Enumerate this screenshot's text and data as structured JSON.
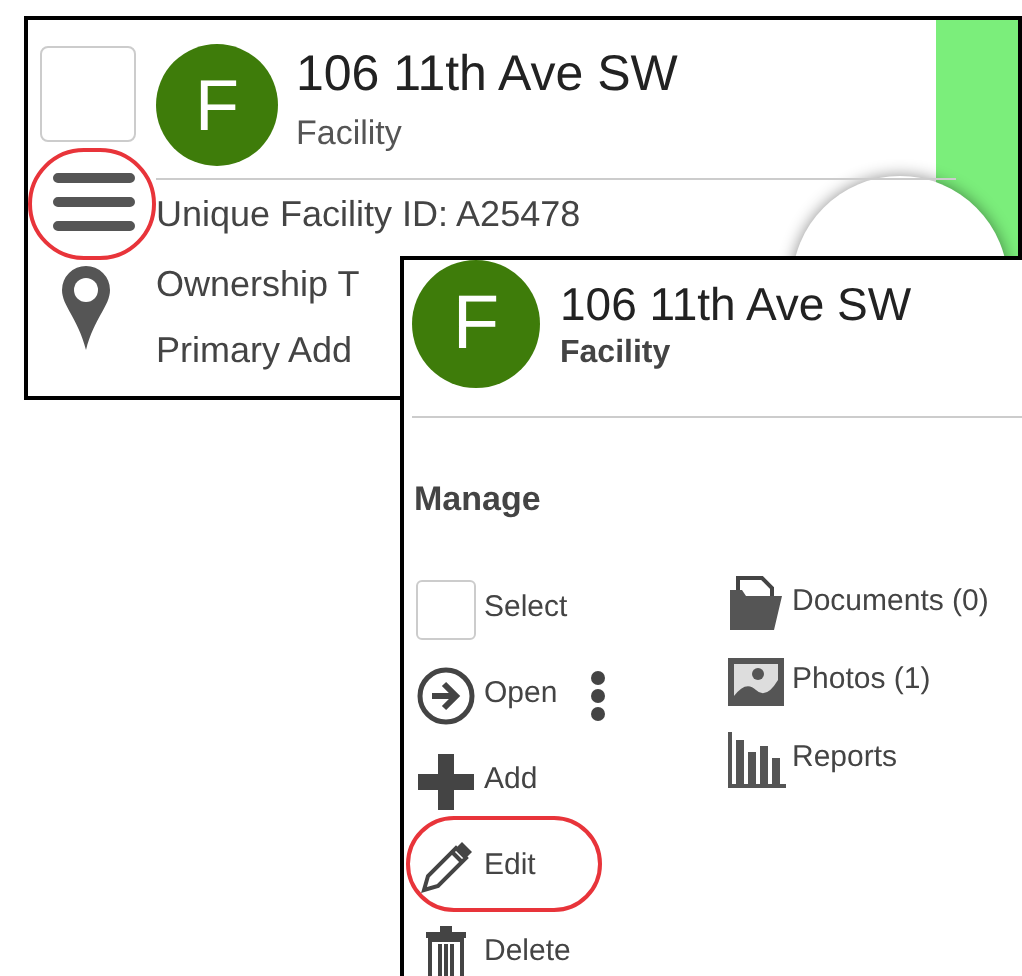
{
  "card": {
    "checkbox": {
      "checked": false
    },
    "avatar": "F",
    "title": "106 11th Ave SW",
    "subtitle": "Facility",
    "menu": {
      "highlighted": true
    },
    "fields": [
      "Unique Facility ID: A25478",
      "Ownership T",
      "Primary Add"
    ]
  },
  "popup": {
    "avatar": "F",
    "title": "106 11th Ave SW",
    "subtitle": "Facility",
    "section": "Manage",
    "actions": [
      {
        "kind": "select",
        "label": "Select",
        "checked": false,
        "highlighted": false
      },
      {
        "kind": "open",
        "label": "Open",
        "highlighted": false
      },
      {
        "kind": "add",
        "label": "Add",
        "highlighted": false
      },
      {
        "kind": "edit",
        "label": "Edit",
        "highlighted": true
      },
      {
        "kind": "delete",
        "label": "Delete",
        "highlighted": false
      }
    ],
    "links": [
      {
        "kind": "documents",
        "label": "Documents (0)"
      },
      {
        "kind": "photos",
        "label": "Photos (1)"
      },
      {
        "kind": "reports",
        "label": "Reports"
      }
    ]
  }
}
